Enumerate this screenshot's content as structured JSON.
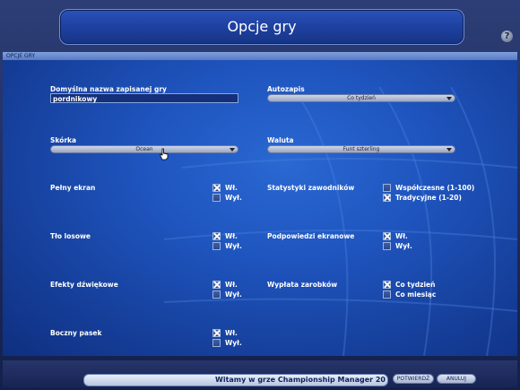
{
  "window": {
    "title": "Opcje gry",
    "help_label": "?"
  },
  "tab": {
    "label": "OPCJE GRY"
  },
  "fields": {
    "save_name": {
      "label": "Domyślna nazwa zapisanej gry",
      "value": "pordnikowy"
    },
    "autosave": {
      "label": "Autozapis",
      "selected": "Co tydzień"
    },
    "skin": {
      "label": "Skórka",
      "selected": "Ocean"
    },
    "currency": {
      "label": "Waluta",
      "selected": "Funt szterling"
    }
  },
  "options": {
    "fullscreen": {
      "label": "Pełny ekran",
      "on": "Wł.",
      "off": "Wył.",
      "on_checked": true,
      "off_checked": false
    },
    "random_bg": {
      "label": "Tło losowe",
      "on": "Wł.",
      "off": "Wył.",
      "on_checked": true,
      "off_checked": false
    },
    "sound": {
      "label": "Efekty dźwiękowe",
      "on": "Wł.",
      "off": "Wył.",
      "on_checked": true,
      "off_checked": false
    },
    "sidebar": {
      "label": "Boczny pasek",
      "on": "Wł.",
      "off": "Wył.",
      "on_checked": true,
      "off_checked": false
    },
    "player_stats": {
      "label": "Statystyki zawodników",
      "a": "Współczesne (1-100)",
      "b": "Tradycyjne (1-20)",
      "a_checked": false,
      "b_checked": true
    },
    "tooltips": {
      "label": "Podpowiedzi ekranowe",
      "on": "Wł.",
      "off": "Wył.",
      "on_checked": true,
      "off_checked": false
    },
    "wages": {
      "label": "Wypłata zarobków",
      "a": "Co tydzień",
      "b": "Co miesiąc",
      "a_checked": true,
      "b_checked": false
    }
  },
  "bottom": {
    "welcome": "Witamy w grze Championship Manager 20",
    "confirm": "POTWIERDŹ",
    "cancel": "ANULUJ"
  },
  "colors": {
    "panel": "#1f55bf",
    "title_bar": "#1d3f9e",
    "accent": "#8aa6e0"
  }
}
